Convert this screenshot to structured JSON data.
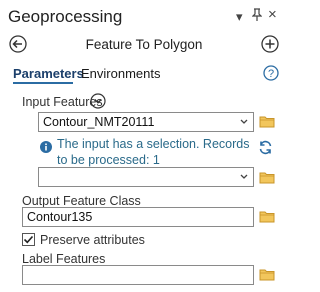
{
  "pane": {
    "title": "Geoprocessing",
    "controls": {
      "dropdown_glyph": "▾",
      "pin_glyph": "ᵖ",
      "close_glyph": "×"
    }
  },
  "tool": {
    "title": "Feature To Polygon"
  },
  "tabs": {
    "parameters": "Parameters",
    "environments": "Environments"
  },
  "params": {
    "input_features_label": "Input Features",
    "input_features_value": "Contour_NMT20111",
    "info_message": "The input has a selection. Records to be processed: 1",
    "second_input_value": "",
    "output_label": "Output Feature Class",
    "output_value": "Contour135",
    "preserve_label": "Preserve attributes",
    "preserve_checked": true,
    "label_features_label": "Label Features",
    "label_features_value": ""
  },
  "colors": {
    "accent": "#2b6ca3",
    "folder": "#e8b84a",
    "info": "#2a6a8a"
  },
  "icons": [
    "back-arrow-icon",
    "add-icon",
    "help-icon",
    "chevron-down-icon",
    "folder-icon",
    "info-icon",
    "refresh-icon",
    "check-icon"
  ]
}
